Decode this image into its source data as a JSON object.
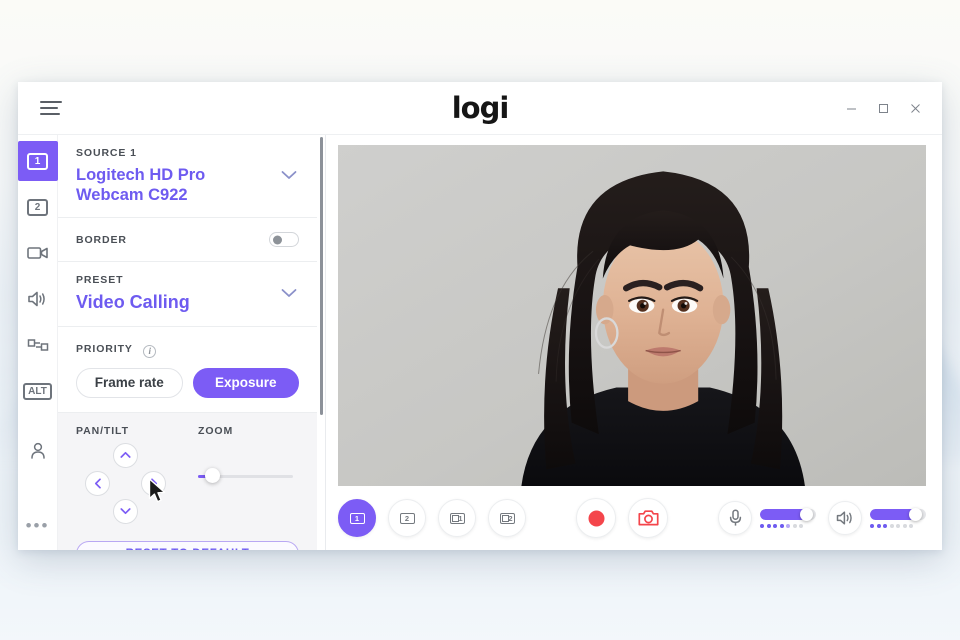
{
  "window": {
    "brand": "logi",
    "menu_icon": "hamburger-icon",
    "controls": {
      "minimize": "minimize-icon",
      "maximize": "maximize-icon",
      "close": "close-icon"
    }
  },
  "rail": {
    "items": [
      {
        "name": "source-1",
        "label": "1",
        "type": "box",
        "active": true
      },
      {
        "name": "source-2",
        "label": "2",
        "type": "box",
        "active": false
      },
      {
        "name": "camera",
        "label": "camcorder-icon",
        "type": "icon",
        "active": false
      },
      {
        "name": "audio",
        "label": "speaker-icon",
        "type": "icon",
        "active": false
      },
      {
        "name": "transition",
        "label": "transition-icon",
        "type": "icon",
        "active": false
      },
      {
        "name": "alt",
        "label": "ALT",
        "type": "box",
        "active": false
      },
      {
        "name": "profile",
        "label": "person-icon",
        "type": "icon",
        "active": false
      }
    ],
    "more": "•••"
  },
  "panel": {
    "source": {
      "label": "SOURCE 1",
      "value": "Logitech HD Pro Webcam C922"
    },
    "border": {
      "label": "BORDER",
      "enabled": false
    },
    "preset": {
      "label": "PRESET",
      "value": "Video Calling"
    },
    "priority": {
      "label": "PRIORITY",
      "info": "i",
      "options": [
        "Frame rate",
        "Exposure"
      ],
      "selected": "Exposure"
    },
    "pantilt": {
      "label": "PAN/TILT",
      "up": "chevron-up-icon",
      "down": "chevron-down-icon",
      "left": "chevron-left-icon",
      "right": "chevron-right-icon"
    },
    "zoom": {
      "label": "ZOOM",
      "value": 14
    },
    "reset": "RESET TO DEFAULT"
  },
  "bottombar": {
    "layouts": [
      {
        "name": "layout-source-1",
        "label": "1",
        "pip": false,
        "active": true
      },
      {
        "name": "layout-source-2",
        "label": "2",
        "pip": false,
        "active": false
      },
      {
        "name": "layout-pip-1",
        "label": "1",
        "pip": true,
        "active": false
      },
      {
        "name": "layout-pip-2",
        "label": "2",
        "pip": true,
        "active": false
      }
    ],
    "record": "record-icon",
    "snapshot": "camera-icon",
    "mic": {
      "icon": "microphone-icon",
      "level": 84,
      "meter": [
        1,
        1,
        1,
        1,
        2,
        0,
        0
      ]
    },
    "speaker": {
      "icon": "speaker-icon",
      "level": 82,
      "meter": [
        1,
        1,
        1,
        0,
        0,
        0,
        0
      ]
    }
  },
  "colors": {
    "accent": "#7c5cf5",
    "accent_text": "#6e5bf0",
    "record": "#f4454b",
    "panel_bg": "#f5f5f7"
  }
}
